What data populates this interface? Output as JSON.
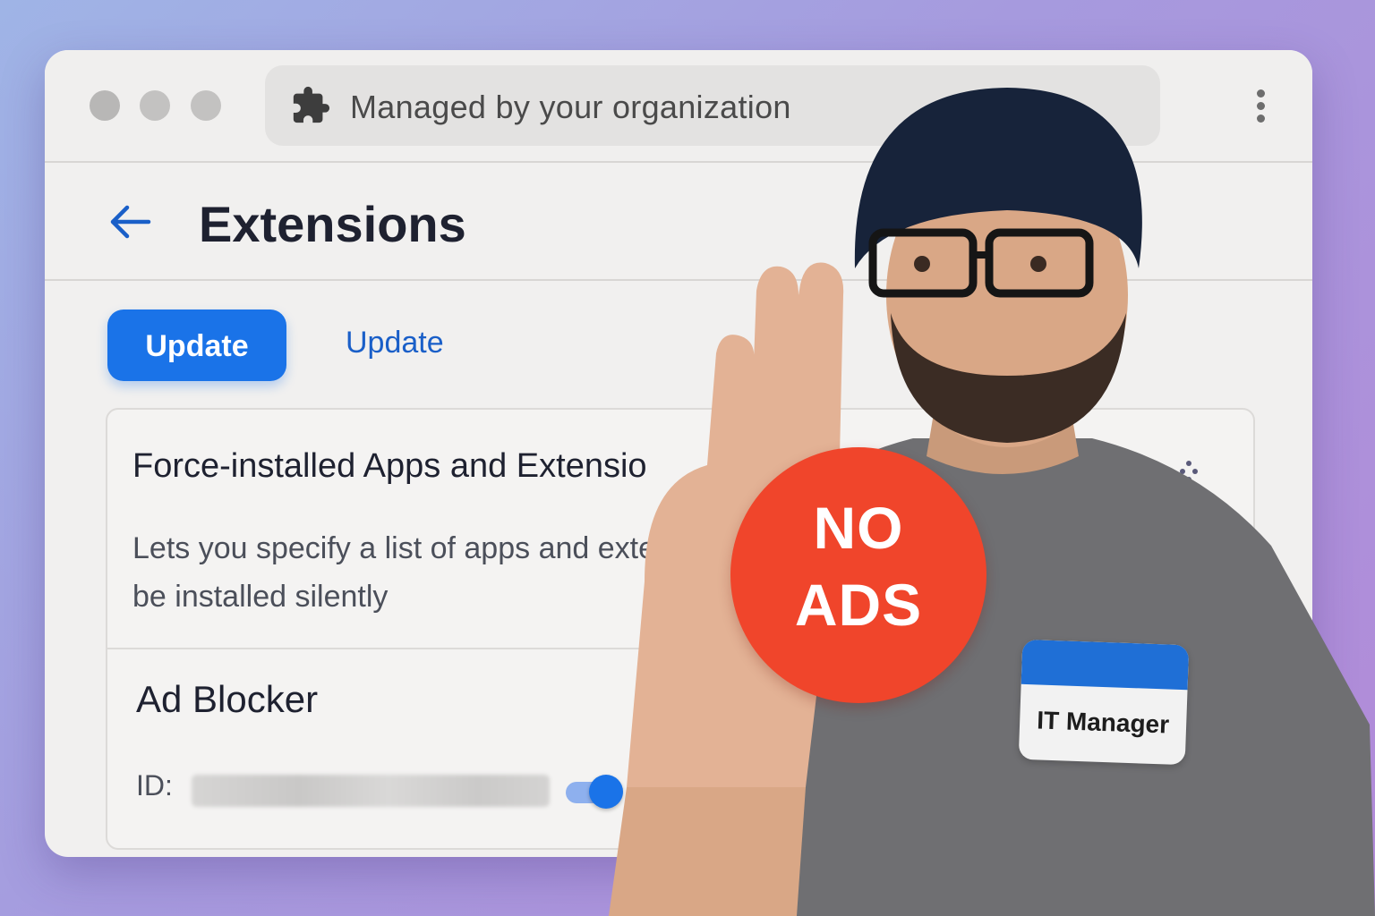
{
  "browser": {
    "address_text": "Managed by your organization",
    "puzzle_icon": "puzzle-icon",
    "menu_icon": "kebab-menu-icon"
  },
  "page": {
    "title": "Extensions",
    "back_icon": "arrow-left-icon"
  },
  "actions": {
    "primary_label": "Update",
    "secondary_label": "Update"
  },
  "policy_card": {
    "title": "Force-installed Apps and Extensio",
    "description": "Lets you specify a list of apps and exte will be installed silently",
    "extension": {
      "name": "Ad Blocker",
      "id_label": "ID:",
      "enabled": true
    }
  },
  "overlay": {
    "badge_line1": "NO",
    "badge_line2": "ADS",
    "nametag_label": "IT Manager"
  },
  "colors": {
    "accent": "#1a73e8",
    "badge_red": "#f0452b",
    "nametag_blue": "#1f6fd6"
  }
}
